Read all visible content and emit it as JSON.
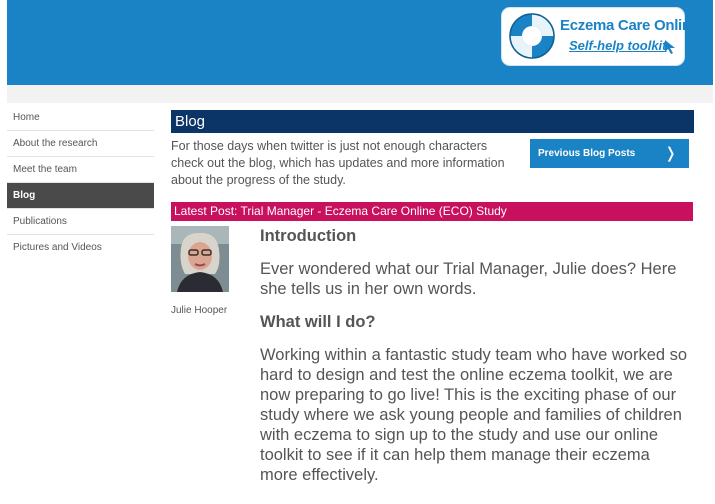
{
  "logo": {
    "title": "Eczema Care Online",
    "subtitle": "Self-help toolkit"
  },
  "sidebar": {
    "items": [
      {
        "label": "Home"
      },
      {
        "label": "About the research"
      },
      {
        "label": "Meet the team"
      },
      {
        "label": "Blog"
      },
      {
        "label": "Publications"
      },
      {
        "label": "Pictures and Videos"
      }
    ],
    "active": "Blog"
  },
  "blog": {
    "heading": "Blog",
    "intro": "For those days when twitter is just not enough characters check out the blog, which has updates and more information about the progress of the study.",
    "previous_button": "Previous Blog Posts",
    "previous_icon": "❭"
  },
  "latest": {
    "label": "Latest Post: Trial Manager - Eczema Care Online (ECO) Study"
  },
  "author": {
    "name": "Julie Hooper"
  },
  "article": {
    "heading1": "Introduction",
    "para1": "Ever wondered what our Trial Manager, Julie does? Here she tells us in her own words.",
    "heading2": "What will I do?",
    "para2": "Working within a fantastic study team who have worked so hard to design and test the online eczema toolkit, we are now preparing to go live! This is the exciting phase of our study where we ask young people and families of children with eczema to sign up to the study and use our online toolkit to see if it can help them manage their eczema more effectively."
  },
  "colors": {
    "header_blue": "#1a83c6",
    "navy": "#0b3467",
    "magenta": "#c8105c",
    "active_nav": "#4a4a4a"
  }
}
